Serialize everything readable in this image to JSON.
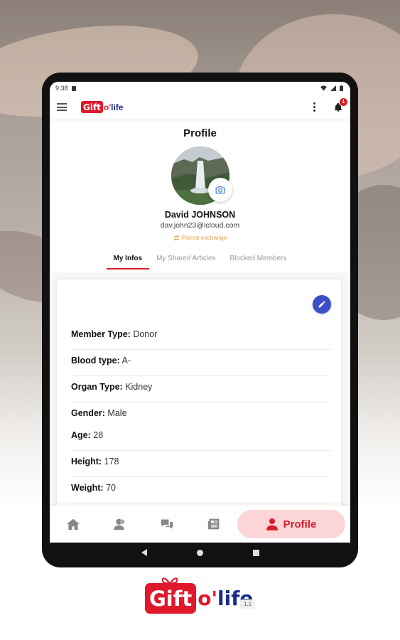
{
  "status_bar": {
    "time": "9:38"
  },
  "app": {
    "logo_gift": "Gift",
    "logo_o": "o'",
    "logo_life": "life",
    "notification_count": "1"
  },
  "profile": {
    "title": "Profile",
    "name": "David JOHNSON",
    "email": "dav.john23@icloud.com",
    "pairing_status": "Paired exchange",
    "tabs": [
      "My Infos",
      "My Shared Articles",
      "Blocked Members"
    ]
  },
  "info": {
    "rows": [
      {
        "label": "Member Type:",
        "value": "Donor"
      },
      {
        "label": "Blood type:",
        "value": "A-"
      },
      {
        "label": "Organ Type:",
        "value": "Kidney"
      },
      {
        "label": "Gender:",
        "value": "Male"
      },
      {
        "label": "Age:",
        "value": "28"
      },
      {
        "label": "Height:",
        "value": "178"
      },
      {
        "label": "Weight:",
        "value": "70"
      }
    ]
  },
  "bottom_nav": {
    "active_label": "Profile"
  },
  "brand": {
    "gift": "Gift",
    "o": "o'",
    "life": "life",
    "version": "1.1"
  },
  "colors": {
    "primary_red": "#d81e2b",
    "accent_blue": "#3a4ec6",
    "active_nav_bg": "#fbd5d7"
  }
}
